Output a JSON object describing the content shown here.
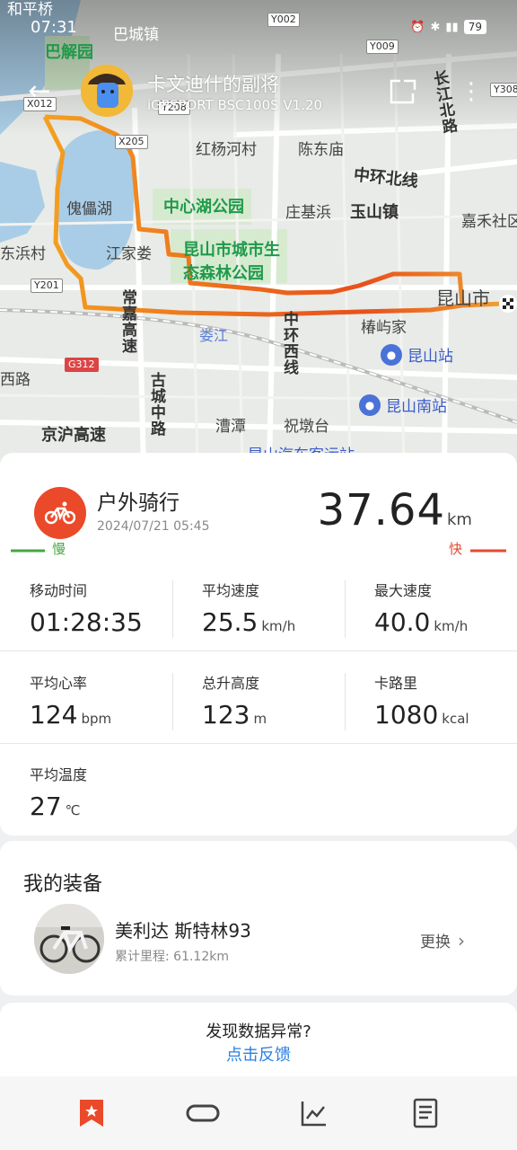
{
  "status_bar": {
    "time": "07:31",
    "battery": "79"
  },
  "header": {
    "user_name": "卡文迪什的副将",
    "device": "iGPSPORT BSC100S  V1.20"
  },
  "map": {
    "labels": {
      "bajieyuan": "巴解园",
      "bacheng": "巴城镇",
      "hepingqiao": "和平桥",
      "hongyanghe": "红杨河村",
      "chendongmiao": "陈东庙",
      "kuileihu": "傀儡湖",
      "zhongxinhu": "中心湖公园",
      "zhuangjibang": "庄基浜",
      "yushanzhen": "玉山镇",
      "jiaheshe": "嘉禾社区",
      "dongbangcun": "东浜村",
      "jiangjialou": "江家娄",
      "kunshan_forest_1": "昆山市城市生",
      "kunshan_forest_2": "态森林公园",
      "kunshanshi": "昆山市",
      "loujiang": "娄江",
      "chunyujia": "椿屿家",
      "xilu": "西路",
      "caotan": "漕潭",
      "zhudunta": "祝墩台",
      "jinghu": "京沪高速",
      "qiche": "昆山汽车客运站",
      "zhonghuan_bei": "中环北线",
      "changjiang_bei": "长江北路",
      "changjia": "常嘉高速",
      "zhonghuan_xi": "中环西线",
      "gucheng": "古城中路",
      "kunshan_station": "昆山站",
      "kunshan_south": "昆山南站",
      "roads": [
        "Y002",
        "Y009",
        "Y308",
        "X012",
        "Y208",
        "X205",
        "Y201",
        "G312"
      ]
    }
  },
  "summary": {
    "activity_type": "户外骑行",
    "date": "2024/07/21 05:45",
    "distance": "37.64",
    "distance_unit": "km",
    "slow": "慢",
    "fast": "快",
    "stats": [
      {
        "label": "移动时间",
        "value": "01:28:35",
        "unit": ""
      },
      {
        "label": "平均速度",
        "value": "25.5",
        "unit": "km/h"
      },
      {
        "label": "最大速度",
        "value": "40.0",
        "unit": "km/h"
      },
      {
        "label": "平均心率",
        "value": "124",
        "unit": "bpm"
      },
      {
        "label": "总升高度",
        "value": "123",
        "unit": "m"
      },
      {
        "label": "卡路里",
        "value": "1080",
        "unit": "kcal"
      },
      {
        "label": "平均温度",
        "value": "27",
        "unit": "℃"
      }
    ]
  },
  "gear": {
    "title": "我的装备",
    "bike_name": "美利达 斯特林93",
    "mileage": "累计里程: 61.12km",
    "change": "更换"
  },
  "feedback": {
    "question": "发现数据异常?",
    "link": "点击反馈"
  },
  "colors": {
    "accent": "#ea4a2a",
    "link": "#2a7fe0",
    "slow": "#43a83f",
    "fast": "#e54a2f"
  }
}
